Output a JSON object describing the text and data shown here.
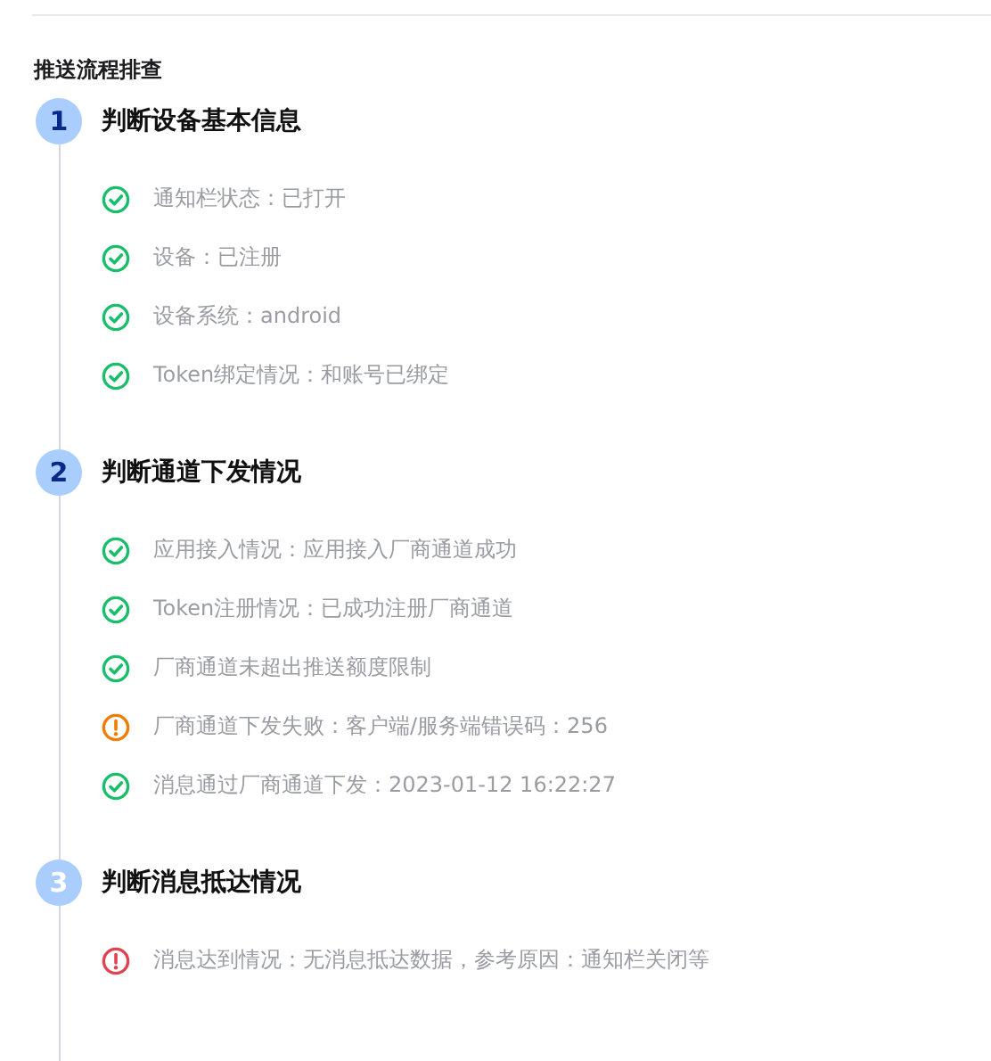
{
  "title": "推送流程排查",
  "steps": [
    {
      "number": "1",
      "title": "判断设备基本信息",
      "completed": true,
      "items": [
        {
          "kind": "success",
          "text": "通知栏状态：已打开"
        },
        {
          "kind": "success",
          "text": "设备：已注册"
        },
        {
          "kind": "success",
          "text": "设备系统：android"
        },
        {
          "kind": "success",
          "text": "Token绑定情况：和账号已绑定"
        }
      ]
    },
    {
      "number": "2",
      "title": "判断通道下发情况",
      "completed": true,
      "items": [
        {
          "kind": "success",
          "text": "应用接入情况：应用接入厂商通道成功"
        },
        {
          "kind": "success",
          "text": "Token注册情况：已成功注册厂商通道"
        },
        {
          "kind": "success",
          "text": "厂商通道未超出推送额度限制"
        },
        {
          "kind": "warning",
          "text": "厂商通道下发失败：客户端/服务端错误码：256"
        },
        {
          "kind": "success",
          "text": "消息通过厂商通道下发：2023-01-12 16:22:27"
        }
      ]
    },
    {
      "number": "3",
      "title": "判断消息抵达情况",
      "completed": false,
      "items": [
        {
          "kind": "error",
          "text": "消息达到情况：无消息抵达数据，参考原因：通知栏关闭等"
        }
      ]
    }
  ]
}
